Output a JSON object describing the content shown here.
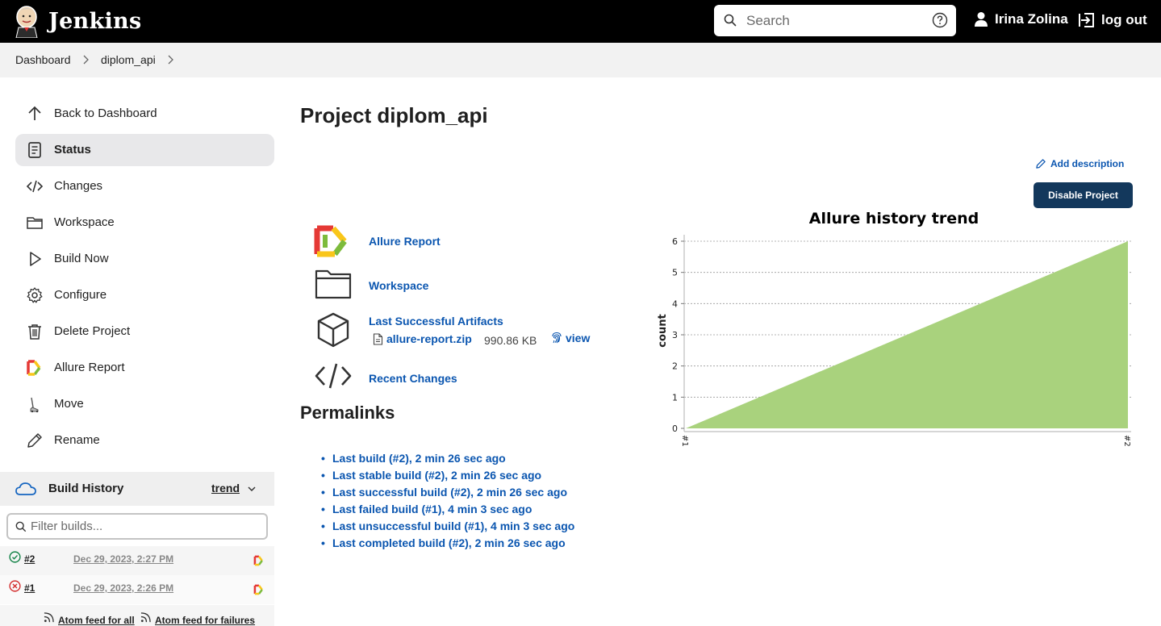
{
  "header": {
    "brand": "Jenkins",
    "search_placeholder": "Search",
    "user_name": "Irina Zolina",
    "logout_label": "log out"
  },
  "breadcrumb": [
    "Dashboard",
    "diplom_api"
  ],
  "sidebar": {
    "items": [
      {
        "label": "Back to Dashboard",
        "icon": "arrow-up-icon"
      },
      {
        "label": "Status",
        "icon": "document-icon",
        "active": true
      },
      {
        "label": "Changes",
        "icon": "code-icon"
      },
      {
        "label": "Workspace",
        "icon": "folder-icon"
      },
      {
        "label": "Build Now",
        "icon": "play-icon"
      },
      {
        "label": "Configure",
        "icon": "gear-icon"
      },
      {
        "label": "Delete Project",
        "icon": "trash-icon"
      },
      {
        "label": "Allure Report",
        "icon": "allure-icon"
      },
      {
        "label": "Move",
        "icon": "move-icon"
      },
      {
        "label": "Rename",
        "icon": "pencil-icon"
      }
    ]
  },
  "build_history": {
    "title": "Build History",
    "trend_label": "trend",
    "filter_placeholder": "Filter builds...",
    "builds": [
      {
        "number": "#2",
        "date": "Dec 29, 2023, 2:27 PM",
        "status": "success"
      },
      {
        "number": "#1",
        "date": "Dec 29, 2023, 2:26 PM",
        "status": "failed"
      }
    ],
    "feed_all": "Atom feed for all",
    "feed_failures": "Atom feed for failures"
  },
  "main": {
    "title": "Project diplom_api",
    "add_description": "Add description",
    "disable_button": "Disable Project",
    "links": {
      "allure_report": "Allure Report",
      "workspace": "Workspace",
      "last_artifacts": "Last Successful Artifacts",
      "recent_changes": "Recent Changes"
    },
    "artifact": {
      "name": "allure-report.zip",
      "size": "990.86 KB",
      "view": "view"
    },
    "permalinks_title": "Permalinks",
    "permalinks": [
      "Last build (#2), 2 min 26 sec ago",
      "Last stable build (#2), 2 min 26 sec ago",
      "Last successful build (#2), 2 min 26 sec ago",
      "Last failed build (#1), 4 min 3 sec ago",
      "Last unsuccessful build (#1), 4 min 3 sec ago",
      "Last completed build (#2), 2 min 26 sec ago"
    ]
  },
  "colors": {
    "link": "#0b56b0",
    "button": "#13385c",
    "area": "#a9d27d",
    "header": "#000000"
  },
  "chart_data": {
    "type": "area",
    "title": "Allure history trend",
    "xlabel": "",
    "ylabel": "count",
    "categories": [
      "#1",
      "#2"
    ],
    "series": [
      {
        "values": [
          0,
          6
        ]
      }
    ],
    "ylim": [
      0,
      6
    ],
    "yticks": [
      "0",
      "1",
      "2",
      "3",
      "4",
      "5",
      "6"
    ],
    "grid": true
  }
}
